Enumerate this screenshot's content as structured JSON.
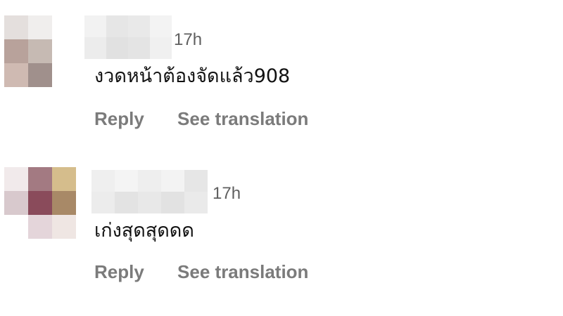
{
  "comments": [
    {
      "time": "17h",
      "text": "งวดหน้าต้องจัดแล้ว908",
      "reply_label": "Reply",
      "translate_label": "See translation",
      "avatar_colors": [
        "#e4dfdd",
        "#f0eeed",
        "#ffffff",
        "#b8a29b",
        "#c6bab3",
        "#ffffff",
        "#cfbab2",
        "#a0908c",
        "#ffffff"
      ],
      "username_colors": [
        "#f2f2f2",
        "#e6e6e6",
        "#e9e9e9",
        "#f3f3f3",
        "#ececec",
        "#e1e1e1",
        "#e4e4e4",
        "#f0f0f0"
      ]
    },
    {
      "time": "17h",
      "text": "เก่งสุดสุดดด",
      "reply_label": "Reply",
      "translate_label": "See translation",
      "avatar_colors": [
        "#f1eaeb",
        "#a37a82",
        "#d5bd8c",
        "#d8c9cd",
        "#8a4b5b",
        "#a88967",
        "#ffffff",
        "#e4d5da",
        "#efe6e3"
      ],
      "username_colors": [
        "#efefef",
        "#f4f4f4",
        "#eeeeee",
        "#f3f3f3",
        "#e6e6e6",
        "#ececec",
        "#e3e3e3",
        "#e8e8e8",
        "#e2e2e2",
        "#eaeaea"
      ]
    }
  ]
}
